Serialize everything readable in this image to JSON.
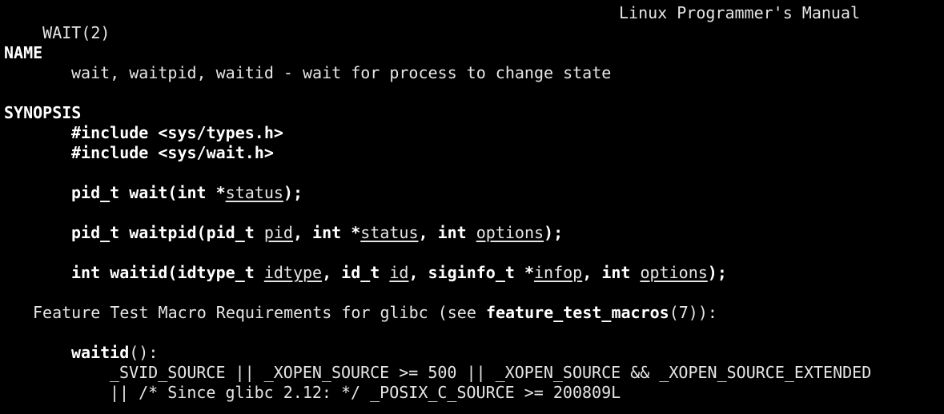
{
  "header": {
    "left": "WAIT(2)",
    "right": "Linux Programmer's Manual"
  },
  "name_section": {
    "heading": "NAME",
    "description": "wait, waitpid, waitid - wait for process to change state"
  },
  "synopsis": {
    "heading": "SYNOPSIS",
    "include1": "#include <sys/types.h>",
    "include2": "#include <sys/wait.h>",
    "wait": {
      "pre": "pid_t wait(int *",
      "arg_status": "status",
      "post": ");"
    },
    "waitpid": {
      "pre": "pid_t waitpid(pid_t ",
      "arg_pid": "pid",
      "sep1": ", int *",
      "arg_status": "status",
      "sep2": ", int ",
      "arg_options": "options",
      "post": ");"
    },
    "waitid": {
      "pre": "int waitid(idtype_t ",
      "arg_idtype": "idtype",
      "sep1": ", id_t ",
      "arg_id": "id",
      "sep2": ", siginfo_t *",
      "arg_infop": "infop",
      "sep3": ", int ",
      "arg_options": "options",
      "post": ");"
    }
  },
  "feature_test": {
    "pre": "Feature Test Macro Requirements for glibc (see ",
    "link": "feature_test_macros",
    "post": "(7)):",
    "func": "waitid",
    "func_suffix": "():",
    "req_line1": "_SVID_SOURCE || _XOPEN_SOURCE >= 500 || _XOPEN_SOURCE && _XOPEN_SOURCE_EXTENDED",
    "req_line2": "|| /* Since glibc 2.12: */ _POSIX_C_SOURCE >= 200809L"
  }
}
